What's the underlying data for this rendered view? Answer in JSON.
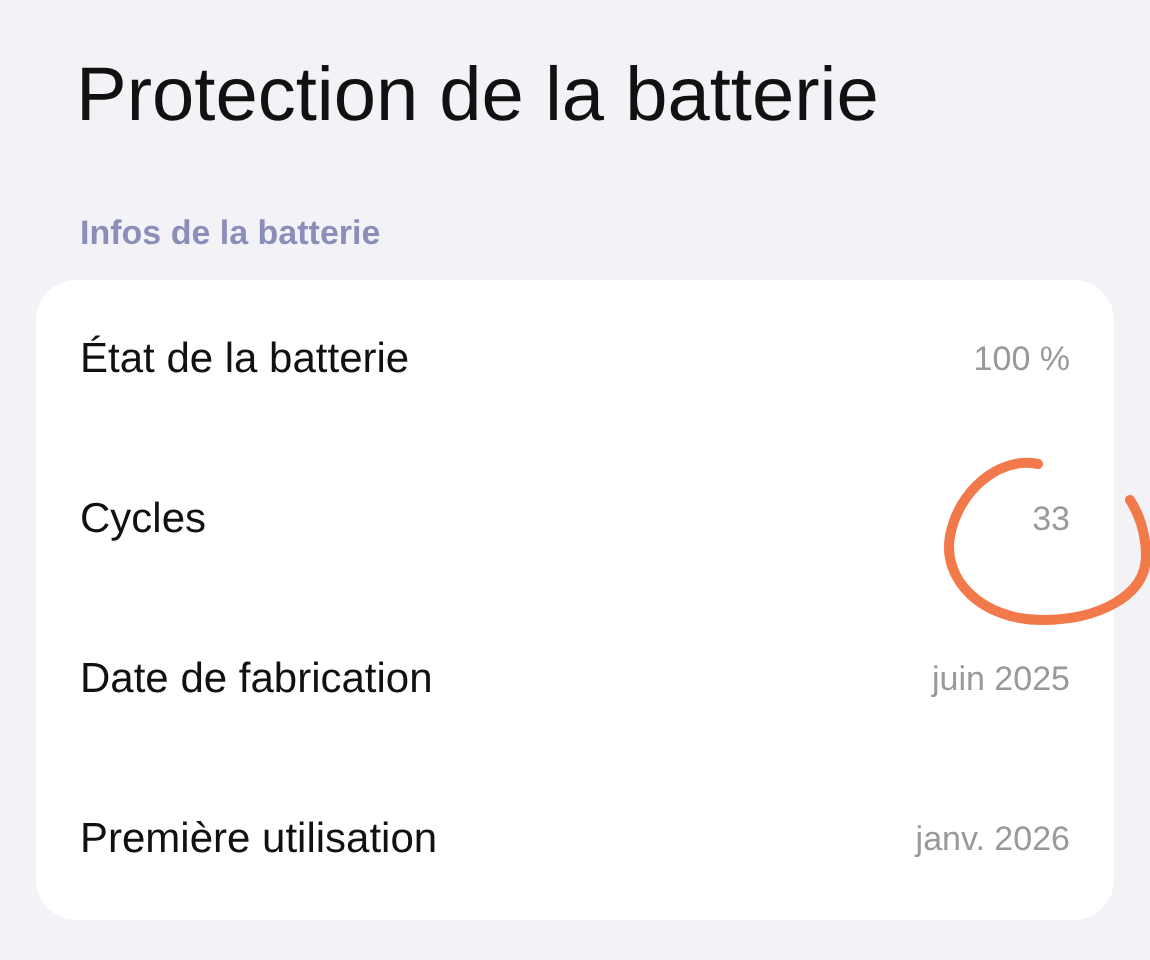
{
  "title": "Protection de la batterie",
  "section": {
    "label": "Infos de la batterie",
    "rows": [
      {
        "label": "État de la batterie",
        "value": "100 %"
      },
      {
        "label": "Cycles",
        "value": "33"
      },
      {
        "label": "Date de fabrication",
        "value": "juin 2025"
      },
      {
        "label": "Première utilisation",
        "value": "janv. 2026"
      }
    ]
  }
}
